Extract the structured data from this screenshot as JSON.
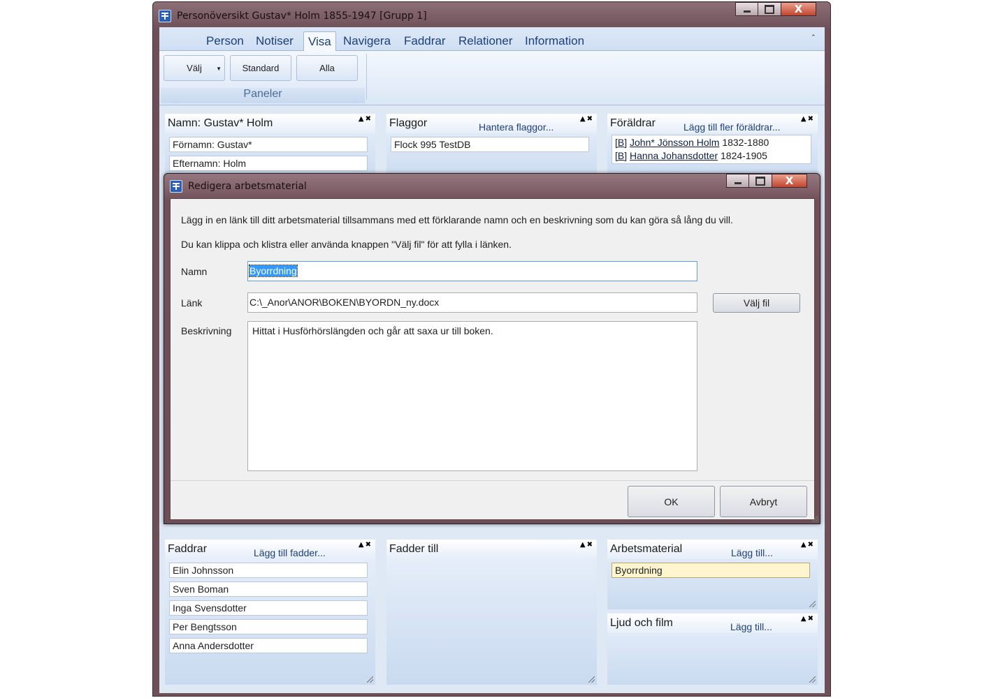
{
  "window": {
    "title": "Personöversikt Gustav* Holm 1855-1947 [Grupp 1]"
  },
  "ribbon": {
    "tabs": [
      {
        "label": "Person"
      },
      {
        "label": "Notiser"
      },
      {
        "label": "Visa"
      },
      {
        "label": "Navigera"
      },
      {
        "label": "Faddrar"
      },
      {
        "label": "Relationer"
      },
      {
        "label": "Information"
      }
    ],
    "active_tab": "Visa",
    "buttons": {
      "valj": "Välj",
      "standard": "Standard",
      "alla": "Alla"
    },
    "group_label": "Paneler"
  },
  "panels": {
    "namn": {
      "title": "Namn: Gustav* Holm",
      "fields": [
        "Förnamn: Gustav*",
        "Efternamn: Holm"
      ]
    },
    "flaggor": {
      "title": "Flaggor",
      "link": "Hantera flaggor...",
      "items": [
        "Flock 995 TestDB"
      ]
    },
    "foraldrar": {
      "title": "Föräldrar",
      "link": "Lägg till fler föräldrar...",
      "parents": [
        {
          "tag": "[B]",
          "name": "John* Jönsson Holm",
          "years": "1832-1880"
        },
        {
          "tag": "[B]",
          "name": "Hanna Johansdotter",
          "years": "1824-1905"
        }
      ]
    },
    "faddrar": {
      "title": "Faddrar",
      "link": "Lägg till fadder...",
      "items": [
        "Elin Johnsson",
        "Sven Boman",
        "Inga Svensdotter",
        "Per Bengtsson",
        "Anna Andersdotter"
      ]
    },
    "fadder_till": {
      "title": "Fadder till"
    },
    "arbetsmaterial": {
      "title": "Arbetsmaterial",
      "link": "Lägg till...",
      "items": [
        "Byorrdning"
      ]
    },
    "ljud_och_film": {
      "title": "Ljud och film",
      "link": "Lägg till..."
    }
  },
  "dialog": {
    "title": "Redigera arbetsmaterial",
    "intro1": "Lägg in en länk till ditt arbetsmaterial tillsammans med ett förklarande namn och en beskrivning som du kan göra så lång du vill.",
    "intro2": "Du kan klippa och klistra eller använda knappen \"Välj fil\" för att fylla i länken.",
    "name_label": "Namn",
    "name_value": "Byorrdning",
    "link_label": "Länk",
    "link_value": "C:\\_Anor\\ANOR\\BOKEN\\BYORDN_ny.docx",
    "choose_file_label": "Välj fil",
    "desc_label": "Beskrivning",
    "desc_value": "Hittat i Husförhörslängden och går att saxa ur till boken.",
    "ok_label": "OK",
    "cancel_label": "Avbryt"
  }
}
